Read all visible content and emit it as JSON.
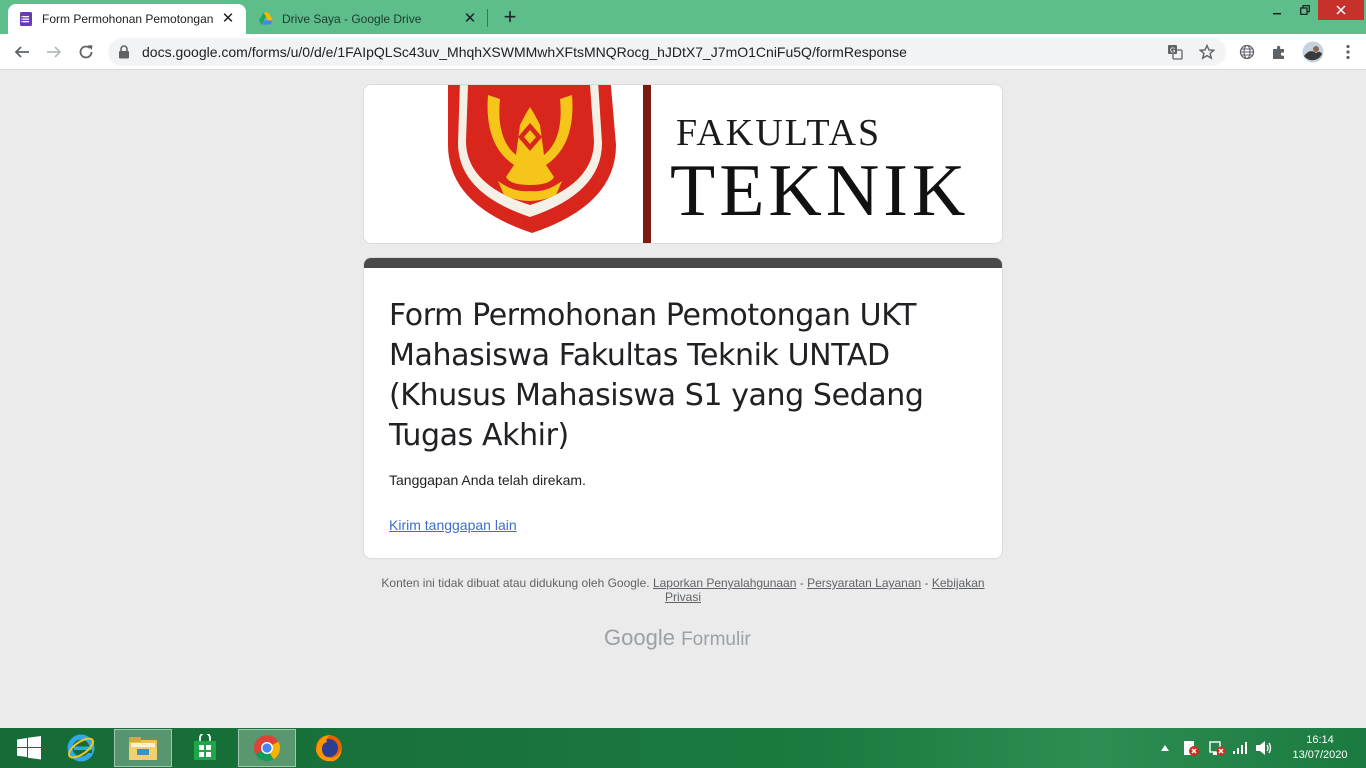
{
  "browser": {
    "tabs": [
      {
        "title": "Form Permohonan Pemotongan",
        "active": true,
        "icon": "google-forms-icon"
      },
      {
        "title": "Drive Saya - Google Drive",
        "active": false,
        "icon": "google-drive-icon"
      }
    ],
    "new_tab_label": "+",
    "address": "docs.google.com/forms/u/0/d/e/1FAIpQLSc43uv_MhqhXSWMMwhXFtsMNQRocg_hJDtX7_J7mO1CniFu5Q/formResponse"
  },
  "header_image": {
    "line1": "FAKULTAS",
    "line2": "TEKNIK",
    "colors": {
      "shield": "#d9261c",
      "emblem": "#f5c51a",
      "divider": "#7a1a10"
    }
  },
  "form": {
    "accent_color": "#4a4a4a",
    "title": "Form Permohonan Pemotongan UKT Mahasiswa Fakultas Teknik UNTAD (Khusus Mahasiswa S1 yang Sedang Tugas Akhir)",
    "confirmation": "Tanggapan Anda telah direkam.",
    "resubmit_link": "Kirim tanggapan lain"
  },
  "footer": {
    "disclaimer": "Konten ini tidak dibuat atau didukung oleh Google.",
    "report_link": "Laporkan Penyalahgunaan",
    "sep": "-",
    "terms_link": "Persyaratan Layanan",
    "privacy_link": "Kebijakan Privasi",
    "brand_google": "Google",
    "brand_forms": "Formulir"
  },
  "taskbar": {
    "apps": [
      "start-icon",
      "internet-explorer-icon",
      "file-explorer-icon",
      "store-icon",
      "chrome-icon",
      "firefox-icon"
    ],
    "time": "16:14",
    "date": "13/07/2020"
  }
}
